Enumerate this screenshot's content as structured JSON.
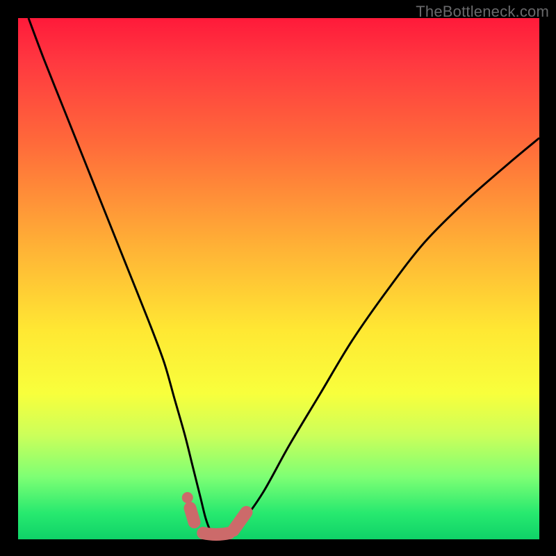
{
  "watermark": "TheBottleneck.com",
  "colors": {
    "background": "#000000",
    "gradient_top": "#ff1a3a",
    "gradient_bottom": "#0fd268",
    "curve": "#000000",
    "marker": "#cc6a6a"
  },
  "chart_data": {
    "type": "line",
    "title": "",
    "xlabel": "",
    "ylabel": "",
    "xlim": [
      0,
      100
    ],
    "ylim": [
      0,
      100
    ],
    "grid": false,
    "legend": false,
    "series": [
      {
        "name": "bottleneck-curve",
        "x": [
          2,
          5,
          9,
          13,
          17,
          21,
          25,
          28,
          30,
          32,
          33.5,
          35,
          36,
          37,
          38,
          40,
          43,
          47,
          52,
          58,
          64,
          71,
          78,
          86,
          94,
          100
        ],
        "y": [
          100,
          92,
          82,
          72,
          62,
          52,
          42,
          34,
          27,
          20,
          14,
          8,
          4,
          1.5,
          1,
          1.3,
          3.5,
          9,
          18,
          28,
          38,
          48,
          57,
          65,
          72,
          77
        ]
      }
    ],
    "markers": {
      "name": "highlight-region",
      "near_bottom_dot": {
        "x": 32.5,
        "y": 8
      },
      "left_dash": {
        "x0": 33,
        "y0": 6,
        "x1": 33.8,
        "y1": 3.3
      },
      "floor_band": {
        "x0": 35.5,
        "y0": 1.2,
        "x1": 40.5,
        "y1": 1.2
      },
      "right_dash": {
        "x0": 41.3,
        "y0": 1.7,
        "x1": 43.8,
        "y1": 5.2
      }
    }
  }
}
